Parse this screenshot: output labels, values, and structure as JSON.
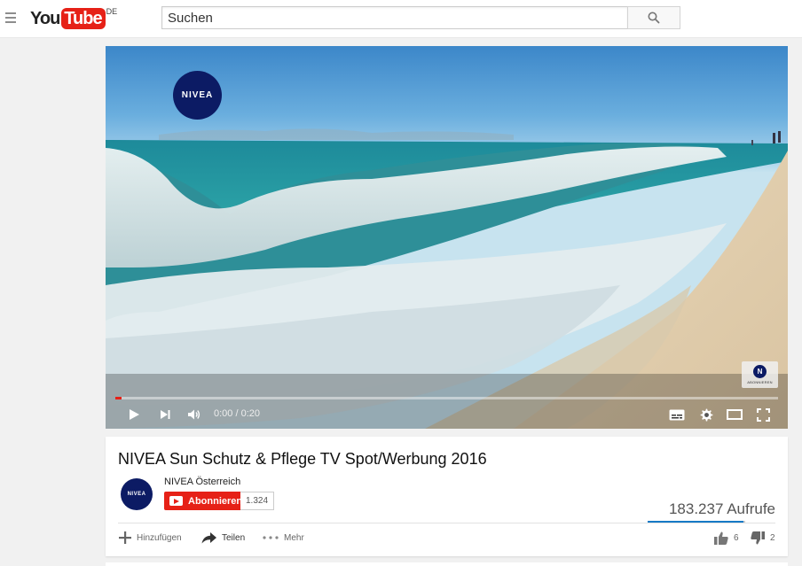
{
  "masthead": {
    "logo_you": "You",
    "logo_tube": "Tube",
    "logo_country": "DE",
    "search_placeholder": "Suchen"
  },
  "player": {
    "brand_badge": "NIVEA",
    "watermark_logo": "N",
    "watermark_text": "ABONNIEREN",
    "time": "0:00 / 0:20",
    "progress_fraction": 0.01
  },
  "video": {
    "title": "NIVEA Sun Schutz & Pflege TV Spot/Werbung 2016",
    "views": "183.237 Aufrufe"
  },
  "channel": {
    "name": "NIVEA Österreich",
    "avatar_text": "NIVEA",
    "subscribe_label": "Abonnieren",
    "subscriber_count": "1.324"
  },
  "actions": {
    "add_label": "Hinzufügen",
    "share_label": "Teilen",
    "more_label": "Mehr",
    "likes": "6",
    "dislikes": "2"
  },
  "colors": {
    "brand_red": "#e62117",
    "nivea_blue": "#0c1b64",
    "like_blue": "#167ac6"
  }
}
